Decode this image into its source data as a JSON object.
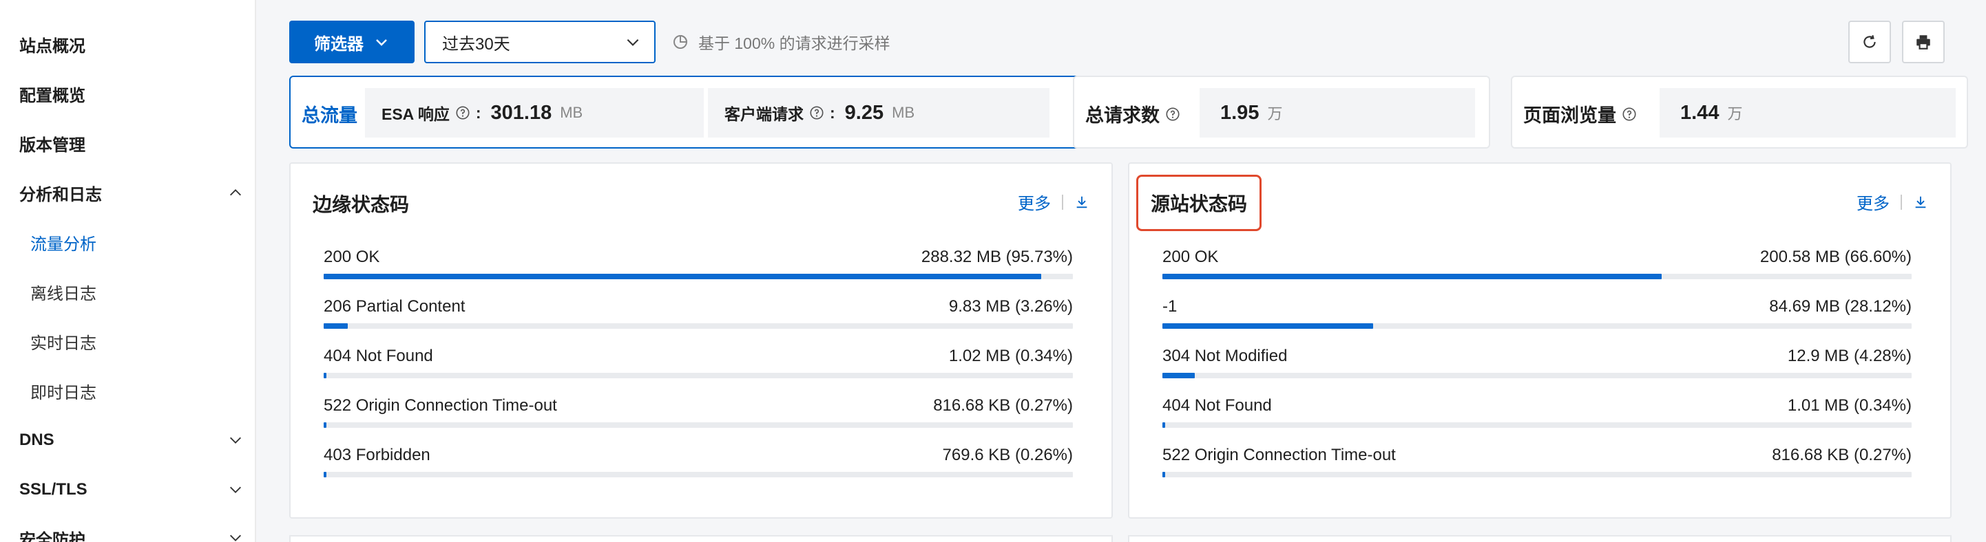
{
  "sidebar": {
    "items": [
      {
        "label": "站点概况",
        "type": "top"
      },
      {
        "label": "配置概览",
        "type": "top"
      },
      {
        "label": "版本管理",
        "type": "top"
      },
      {
        "label": "分析和日志",
        "type": "group",
        "expanded": true
      },
      {
        "label": "流量分析",
        "type": "sub",
        "active": true
      },
      {
        "label": "离线日志",
        "type": "sub"
      },
      {
        "label": "实时日志",
        "type": "sub"
      },
      {
        "label": "即时日志",
        "type": "sub"
      },
      {
        "label": "DNS",
        "type": "group",
        "expanded": false
      },
      {
        "label": "SSL/TLS",
        "type": "group",
        "expanded": false
      },
      {
        "label": "安全防护",
        "type": "group",
        "expanded": false
      }
    ]
  },
  "toolbar": {
    "filter_label": "筛选器",
    "date_range": "过去30天",
    "sample_note": "基于 100% 的请求进行采样",
    "refresh_icon": "refresh-icon",
    "print_icon": "print-icon"
  },
  "summary": {
    "total": {
      "label": "总流量",
      "esa": {
        "label": "ESA 响应",
        "value": "301.18",
        "unit": "MB"
      },
      "client": {
        "label": "客户端请求",
        "value": "9.25",
        "unit": "MB"
      }
    },
    "requests": {
      "label": "总请求数",
      "value": "1.95",
      "unit": "万"
    },
    "pageviews": {
      "label": "页面浏览量",
      "value": "1.44",
      "unit": "万"
    }
  },
  "panels": {
    "edge": {
      "title": "边缘状态码",
      "more": "更多",
      "rows": [
        {
          "label": "200 OK",
          "value": "288.32 MB (95.73%)",
          "fraction": 0.9573
        },
        {
          "label": "206 Partial Content",
          "value": "9.83 MB (3.26%)",
          "fraction": 0.0326
        },
        {
          "label": "404 Not Found",
          "value": "1.02 MB (0.34%)",
          "fraction": 0.0034
        },
        {
          "label": "522 Origin Connection Time-out",
          "value": "816.68 KB (0.27%)",
          "fraction": 0.0027
        },
        {
          "label": "403 Forbidden",
          "value": "769.6 KB (0.26%)",
          "fraction": 0.0026
        }
      ]
    },
    "origin": {
      "title": "源站状态码",
      "more": "更多",
      "rows": [
        {
          "label": "200 OK",
          "value": "200.58 MB (66.60%)",
          "fraction": 0.666
        },
        {
          "label": "-1",
          "value": "84.69 MB (28.12%)",
          "fraction": 0.2812
        },
        {
          "label": "304 Not Modified",
          "value": "12.9 MB (4.28%)",
          "fraction": 0.0428
        },
        {
          "label": "404 Not Found",
          "value": "1.01 MB (0.34%)",
          "fraction": 0.0034
        },
        {
          "label": "522 Origin Connection Time-out",
          "value": "816.68 KB (0.27%)",
          "fraction": 0.0027
        }
      ]
    }
  },
  "colors": {
    "accent": "#0064c8",
    "bar": "#0a6ad1",
    "highlight_border": "#e0492d"
  }
}
